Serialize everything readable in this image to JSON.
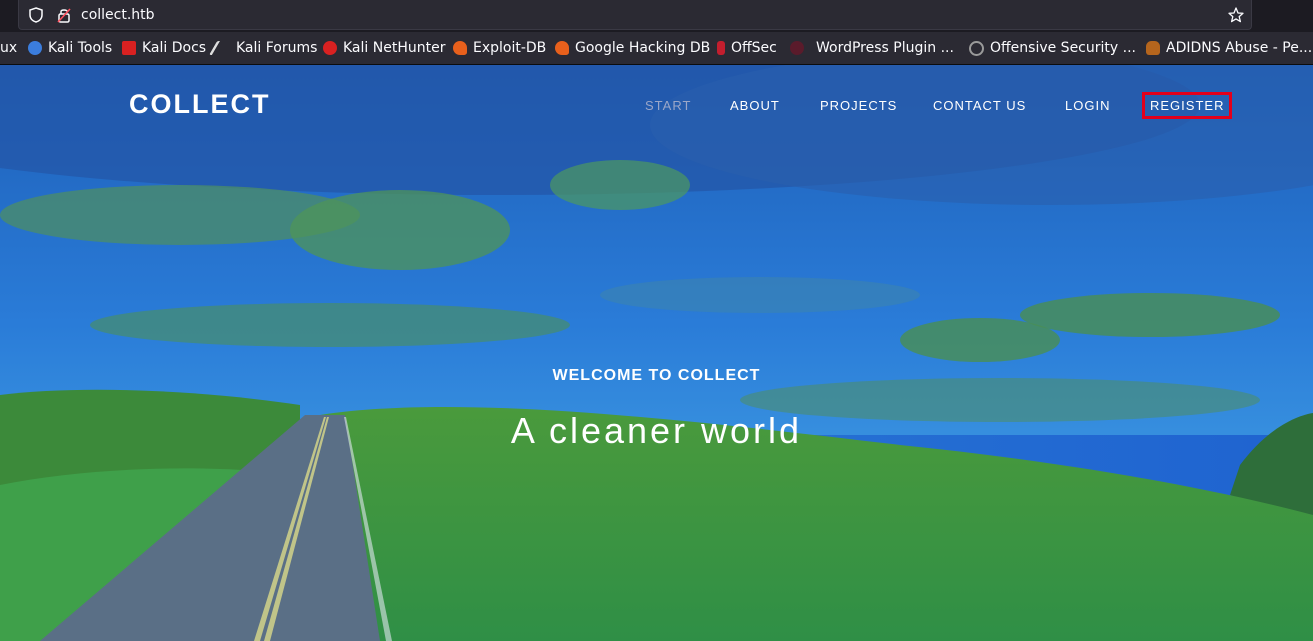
{
  "browser": {
    "url": "collect.htb",
    "bookmarks": [
      {
        "label": "ux",
        "icon": "kali-linux-icon",
        "color": "#557dbb"
      },
      {
        "label": "Kali Tools",
        "icon": "kali-tools-icon",
        "color": "#3b7ddd"
      },
      {
        "label": "Kali Docs",
        "icon": "kali-docs-icon",
        "color": "#d92121"
      },
      {
        "label": "Kali Forums",
        "icon": "kali-forums-icon",
        "color": "#cccccc"
      },
      {
        "label": "Kali NetHunter",
        "icon": "kali-nethunter-icon",
        "color": "#d92121"
      },
      {
        "label": "Exploit-DB",
        "icon": "exploit-db-icon",
        "color": "#e8601c"
      },
      {
        "label": "Google Hacking DB",
        "icon": "ghdb-icon",
        "color": "#e8601c"
      },
      {
        "label": "OffSec",
        "icon": "offsec-icon",
        "color": "#c31e2e"
      },
      {
        "label": "WordPress Plugin ...",
        "icon": "wordpress-plugin-icon",
        "color": "#7a1b2b"
      },
      {
        "label": "Offensive Security ...",
        "icon": "offensive-security-icon",
        "color": "#9a9a9a"
      },
      {
        "label": "ADIDNS Abuse - Pe...",
        "icon": "adidns-icon",
        "color": "#b5651d"
      }
    ]
  },
  "site": {
    "brand": "COLLECT",
    "nav": [
      {
        "label": "START",
        "state": "active"
      },
      {
        "label": "ABOUT",
        "state": "normal"
      },
      {
        "label": "PROJECTS",
        "state": "normal"
      },
      {
        "label": "CONTACT US",
        "state": "normal"
      },
      {
        "label": "LOGIN",
        "state": "normal"
      },
      {
        "label": "REGISTER",
        "state": "highlighted"
      }
    ],
    "hero": {
      "welcome": "WELCOME TO COLLECT",
      "tagline": "A cleaner world"
    },
    "colors": {
      "highlight_box": "#e3001b",
      "hero_tint": "#1a6ad6",
      "grass": "#3aa84a"
    }
  }
}
